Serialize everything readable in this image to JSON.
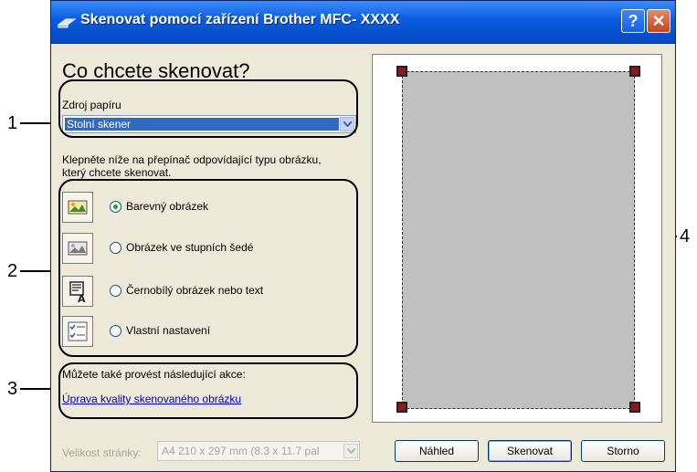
{
  "window": {
    "title": "Skenovat pomocí zařízení Brother MFC- XXXX",
    "help_label": "?",
    "close_label": "✕"
  },
  "main": {
    "heading": "Co chcete skenovat?",
    "source_label": "Zdroj papíru",
    "source_value": "Stolní skener",
    "instruction_line1": "Klepněte níže na přepínač odpovídající typu obrázku,",
    "instruction_line2": "který chcete skenovat.",
    "types": [
      {
        "label": "Barevný obrázek",
        "icon": "color-photo-icon",
        "checked": true
      },
      {
        "label": "Obrázek ve stupních šedé",
        "icon": "grayscale-photo-icon",
        "checked": false
      },
      {
        "label": "Černobílý obrázek nebo text",
        "icon": "bw-text-icon",
        "checked": false
      },
      {
        "label": "Vlastní nastavení",
        "icon": "custom-settings-icon",
        "checked": false
      }
    ],
    "also_text": "Můžete také provést následující akce:",
    "link_text": "Úprava kvality skenovaného obrázku"
  },
  "footer": {
    "page_size_label": "Velikost stránky:",
    "page_size_value": "A4 210 x 297 mm (8.3 x 11.7 pal",
    "preview_button": "Náhled",
    "scan_button": "Skenovat",
    "cancel_button": "Storno"
  },
  "callouts": [
    "1",
    "2",
    "3",
    "4"
  ],
  "colors": {
    "titlebar": "#0a5bde",
    "dialog_bg": "#ece9d8",
    "selection": "#316ac5",
    "preview_area": "#c0c0c0",
    "handles": "#8b1a1a"
  }
}
